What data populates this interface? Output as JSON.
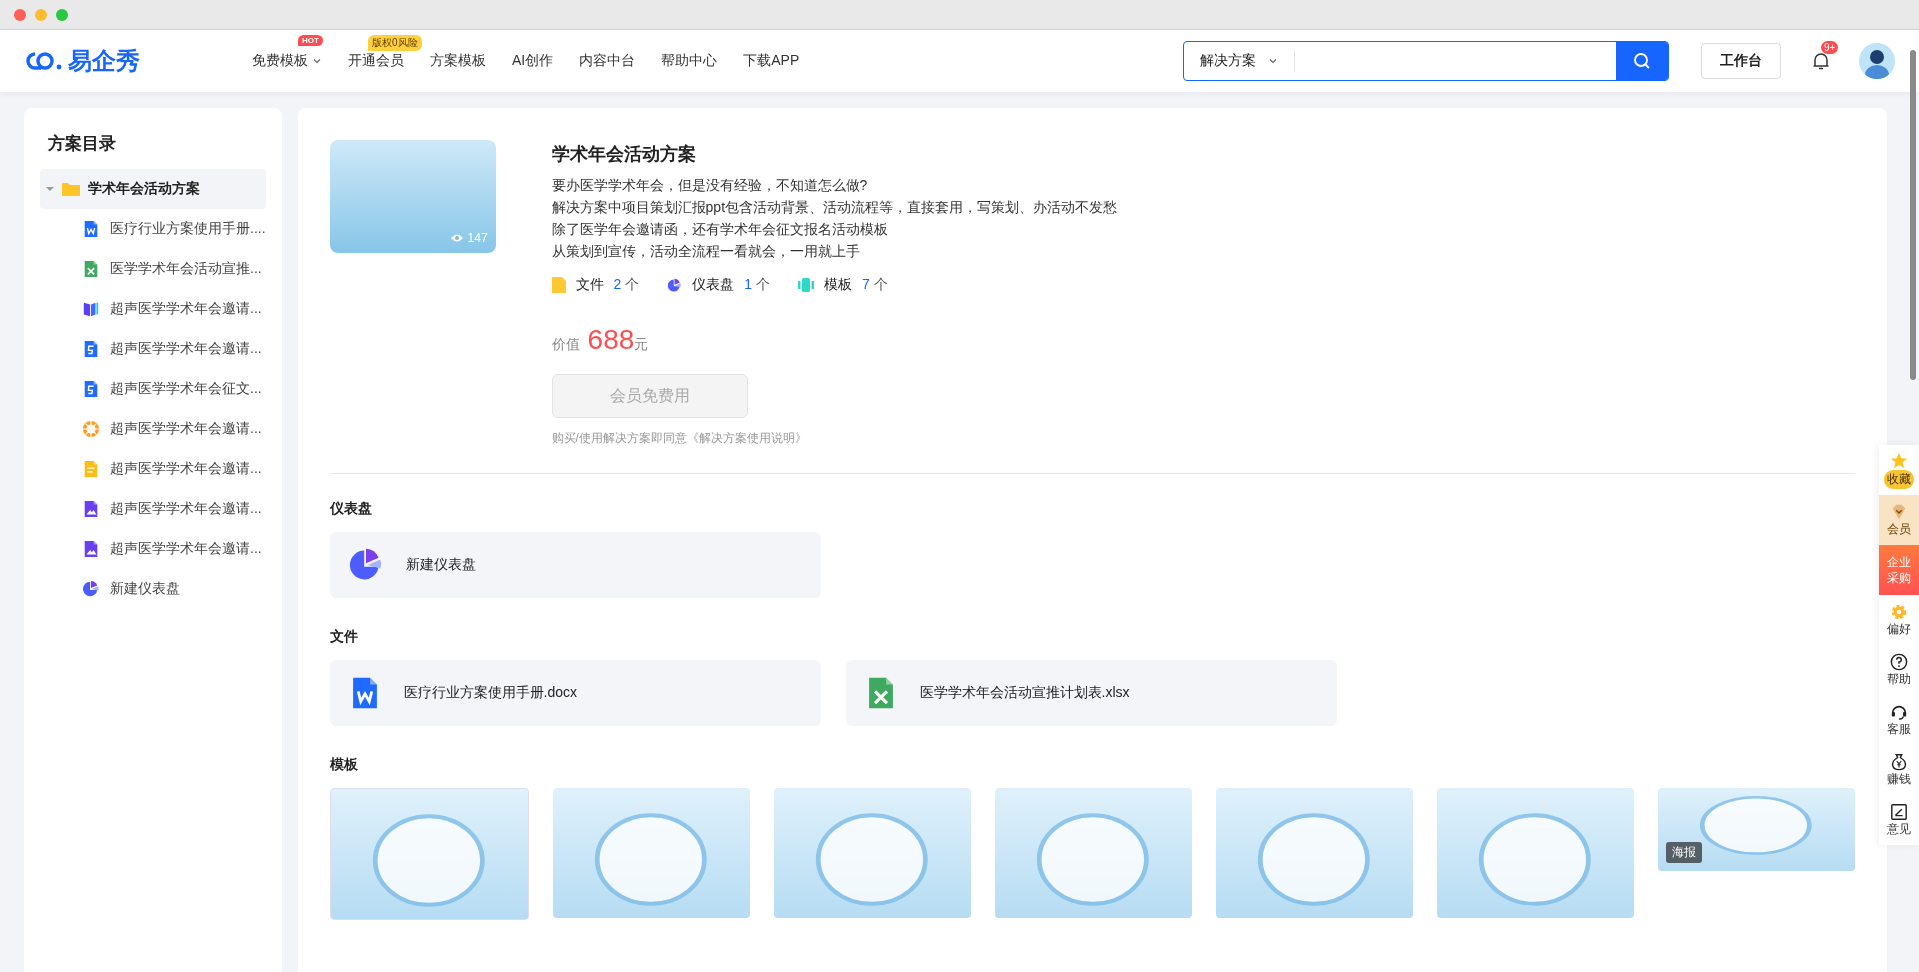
{
  "header": {
    "logo": "易企秀",
    "nav": [
      {
        "label": "免费模板",
        "badge": "HOT",
        "dropdown": true
      },
      {
        "label": "开通会员",
        "badge": "版权0风险",
        "dropdown": false
      },
      {
        "label": "方案模板",
        "dropdown": false
      },
      {
        "label": "AI创作",
        "dropdown": false
      },
      {
        "label": "内容中台",
        "dropdown": false
      },
      {
        "label": "帮助中心",
        "dropdown": false
      },
      {
        "label": "下载APP",
        "dropdown": false
      }
    ],
    "search": {
      "category": "解决方案"
    },
    "workbench": "工作台",
    "notifications": "9+"
  },
  "sidebar": {
    "title": "方案目录",
    "tree": [
      {
        "label": "学术年会活动方案",
        "expanded": true,
        "selected": true,
        "children": [
          {
            "label": "医疗行业方案使用手册....",
            "kind": "word",
            "selected": false
          },
          {
            "label": "医学学术年会活动宣推...",
            "kind": "excel",
            "selected": false
          },
          {
            "label": "超声医学学术年会邀请...",
            "kind": "book",
            "selected": false
          },
          {
            "label": "超声医学学术年会邀请...",
            "kind": "h5",
            "selected": false
          },
          {
            "label": "超声医学学术年会征文...",
            "kind": "h5",
            "selected": false
          },
          {
            "label": "超声医学学术年会邀请...",
            "kind": "wheel",
            "selected": false
          },
          {
            "label": "超声医学学术年会邀请...",
            "kind": "doc",
            "selected": false
          },
          {
            "label": "超声医学学术年会邀请...",
            "kind": "image",
            "selected": false
          },
          {
            "label": "超声医学学术年会邀请...",
            "kind": "image",
            "selected": false
          },
          {
            "label": "新建仪表盘",
            "kind": "dashboard",
            "selected": false
          }
        ]
      }
    ]
  },
  "solution": {
    "views": "147",
    "title": "学术年会活动方案",
    "description": [
      "要办医学学术年会，但是没有经验，不知道怎么做?",
      "解决方案中项目策划汇报ppt包含活动背景、活动流程等，直接套用，写策划、办活动不发愁",
      "除了医学年会邀请函，还有学术年会征文报名活动模板",
      "从策划到宣传，活动全流程一看就会，一用就上手"
    ],
    "stats": [
      {
        "kind": "file",
        "label": "文件",
        "count": "2",
        "unit": "个"
      },
      {
        "kind": "dashboard",
        "label": "仪表盘",
        "count": "1",
        "unit": "个"
      },
      {
        "kind": "template",
        "label": "模板",
        "count": "7",
        "unit": "个"
      }
    ],
    "price": {
      "label": "价值",
      "amount": "688",
      "unit": "元"
    },
    "button": {
      "label": "会员免费用",
      "disabled": true
    },
    "agreement": "购买/使用解决方案即同意《解决方案使用说明》"
  },
  "sections": [
    {
      "title": "仪表盘",
      "items": [
        {
          "kind": "dashboard",
          "label": "新建仪表盘"
        }
      ]
    },
    {
      "title": "文件",
      "items": [
        {
          "kind": "word",
          "label": "医疗行业方案使用手册.docx"
        },
        {
          "kind": "excel",
          "label": "医学学术年会活动宣推计划表.xlsx"
        }
      ]
    }
  ],
  "templates": {
    "title": "模板",
    "items": [
      {
        "kind": "slide"
      },
      {
        "kind": "poster"
      },
      {
        "kind": "poster"
      },
      {
        "kind": "poster"
      },
      {
        "kind": "poster"
      },
      {
        "kind": "poster"
      },
      {
        "kind": "banner",
        "tag": "海报"
      }
    ]
  },
  "side_rail": [
    {
      "kind": "favorite",
      "label": "收藏"
    },
    {
      "kind": "vip",
      "label": "会员"
    },
    {
      "kind": "enterprise",
      "label": "企业采购"
    },
    {
      "kind": "preference",
      "label": "偏好"
    },
    {
      "kind": "help",
      "label": "帮助"
    },
    {
      "kind": "service",
      "label": "客服"
    },
    {
      "kind": "earn",
      "label": "赚钱"
    },
    {
      "kind": "feedback",
      "label": "意见"
    }
  ]
}
